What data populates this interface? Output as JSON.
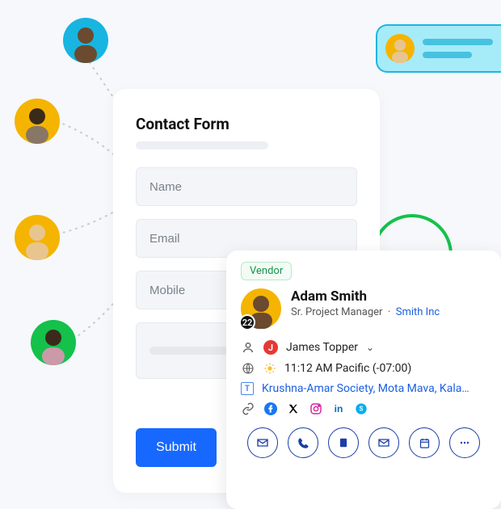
{
  "form": {
    "title": "Contact Form",
    "placeholders": {
      "name": "Name",
      "email": "Email",
      "mobile": "Mobile"
    },
    "submit_label": "Submit"
  },
  "contact": {
    "tag": "Vendor",
    "name": "Adam Smith",
    "role": "Sr. Project Manager",
    "separator": "·",
    "company": "Smith Inc",
    "avatar_count": "22",
    "owner": {
      "initial": "J",
      "name": "James Topper"
    },
    "timezone_text": "11:12 AM Pacific (-07:00)",
    "address_prefix": "T",
    "address": "Krushna-Amar Society, Mota Mava, Kalaw...",
    "social": [
      "facebook",
      "x",
      "instagram",
      "linkedin",
      "skype"
    ],
    "actions": [
      "mail",
      "call",
      "note",
      "mail2",
      "calendar",
      "more"
    ]
  }
}
